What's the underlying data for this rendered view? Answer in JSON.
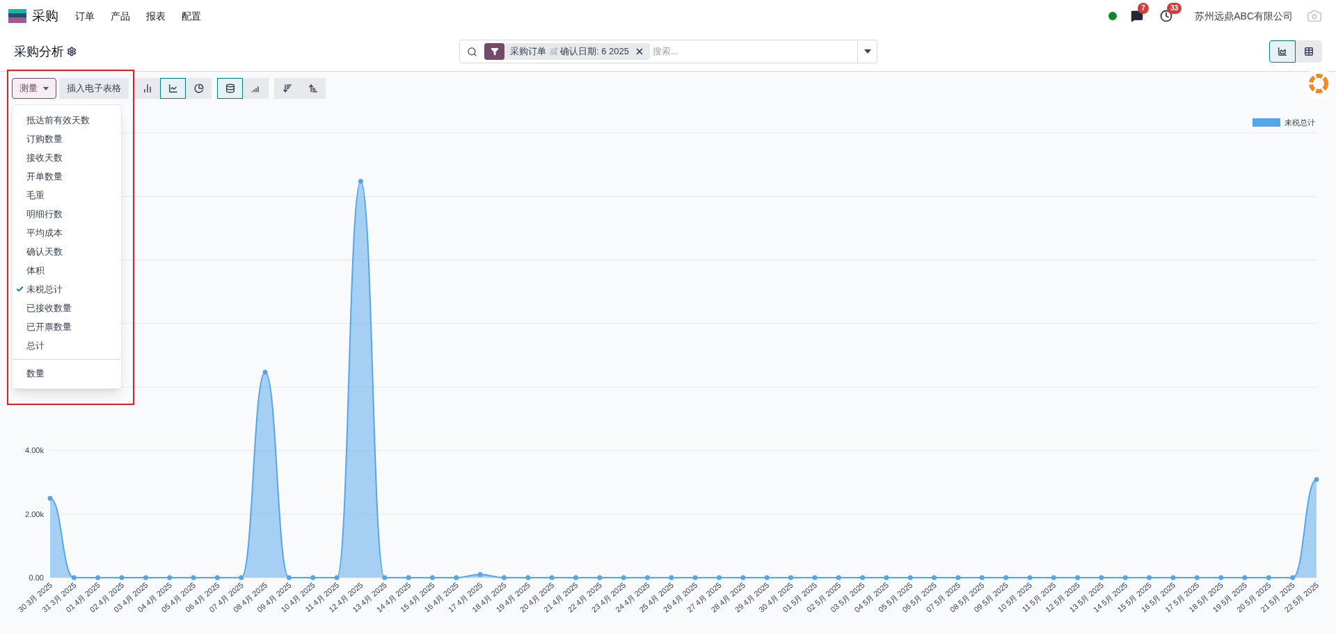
{
  "navbar": {
    "app_name": "采购",
    "menu": [
      "订单",
      "产品",
      "报表",
      "配置"
    ],
    "messages_badge": "7",
    "activities_badge": "33",
    "company": "苏州远鼎ABC有限公司"
  },
  "control_panel": {
    "title": "采购分析",
    "search": {
      "facet_values": [
        "采购订单",
        "确认日期: 6 2025"
      ],
      "facet_separator": "或",
      "placeholder": "搜索..."
    },
    "views": [
      {
        "kind": "graph",
        "selected": true
      },
      {
        "kind": "pivot",
        "selected": false
      }
    ]
  },
  "toolbar": {
    "measure_button": {
      "label": "测量",
      "open": true
    },
    "insert_button": "插入电子表格",
    "chart_types": [
      {
        "kind": "bar",
        "selected": false
      },
      {
        "kind": "line",
        "selected": true
      },
      {
        "kind": "pie",
        "selected": false
      }
    ],
    "line_options": [
      {
        "kind": "stacked",
        "selected": true
      },
      {
        "kind": "cumulative",
        "selected": false
      }
    ],
    "sort": [
      {
        "kind": "descending"
      },
      {
        "kind": "ascending"
      }
    ]
  },
  "measures_menu": {
    "items": [
      {
        "label": "抵达前有效天数",
        "checked": false
      },
      {
        "label": "订购数量",
        "checked": false
      },
      {
        "label": "接收天数",
        "checked": false
      },
      {
        "label": "开单数量",
        "checked": false
      },
      {
        "label": "毛重",
        "checked": false
      },
      {
        "label": "明细行数",
        "checked": false
      },
      {
        "label": "平均成本",
        "checked": false
      },
      {
        "label": "确认天数",
        "checked": false
      },
      {
        "label": "体积",
        "checked": false
      },
      {
        "label": "未税总计",
        "checked": true
      },
      {
        "label": "已接收数量",
        "checked": false
      },
      {
        "label": "已开票数量",
        "checked": false
      },
      {
        "label": "总计",
        "checked": false
      }
    ],
    "count_item": {
      "label": "数量",
      "checked": false
    }
  },
  "chart": {
    "chart_data": {
      "type": "area",
      "categories": [
        "30 3月 2025",
        "31 3月 2025",
        "01 4月 2025",
        "02 4月 2025",
        "03 4月 2025",
        "04 4月 2025",
        "05 4月 2025",
        "06 4月 2025",
        "07 4月 2025",
        "08 4月 2025",
        "09 4月 2025",
        "10 4月 2025",
        "11 4月 2025",
        "12 4月 2025",
        "13 4月 2025",
        "14 4月 2025",
        "15 4月 2025",
        "16 4月 2025",
        "17 4月 2025",
        "18 4月 2025",
        "19 4月 2025",
        "20 4月 2025",
        "21 4月 2025",
        "22 4月 2025",
        "23 4月 2025",
        "24 4月 2025",
        "25 4月 2025",
        "26 4月 2025",
        "27 4月 2025",
        "28 4月 2025",
        "29 4月 2025",
        "30 4月 2025",
        "01 5月 2025",
        "02 5月 2025",
        "03 5月 2025",
        "04 5月 2025",
        "05 5月 2025",
        "06 5月 2025",
        "07 5月 2025",
        "08 5月 2025",
        "09 5月 2025",
        "10 5月 2025",
        "11 5月 2025",
        "12 5月 2025",
        "13 5月 2025",
        "14 5月 2025",
        "15 5月 2025",
        "16 5月 2025",
        "17 5月 2025",
        "18 5月 2025",
        "19 5月 2025",
        "20 5月 2025",
        "21 5月 2025",
        "22 5月 2025"
      ],
      "series": [
        {
          "name": "未税总计",
          "color": "#54a6ec",
          "values": [
            2500,
            0,
            0,
            0,
            0,
            0,
            0,
            0,
            0,
            6470,
            0,
            0,
            0,
            12480,
            0,
            0,
            0,
            0,
            100,
            0,
            0,
            0,
            0,
            0,
            0,
            0,
            0,
            0,
            0,
            0,
            0,
            0,
            0,
            0,
            0,
            0,
            0,
            0,
            0,
            0,
            0,
            0,
            0,
            0,
            0,
            0,
            0,
            0,
            0,
            0,
            0,
            0,
            0,
            3090
          ]
        }
      ],
      "ylim": [
        0,
        14000
      ],
      "yticks": [
        {
          "value": 0,
          "label": "0.00"
        },
        {
          "value": 2000,
          "label": "2.00k"
        },
        {
          "value": 4000,
          "label": "4.00k"
        }
      ]
    }
  }
}
